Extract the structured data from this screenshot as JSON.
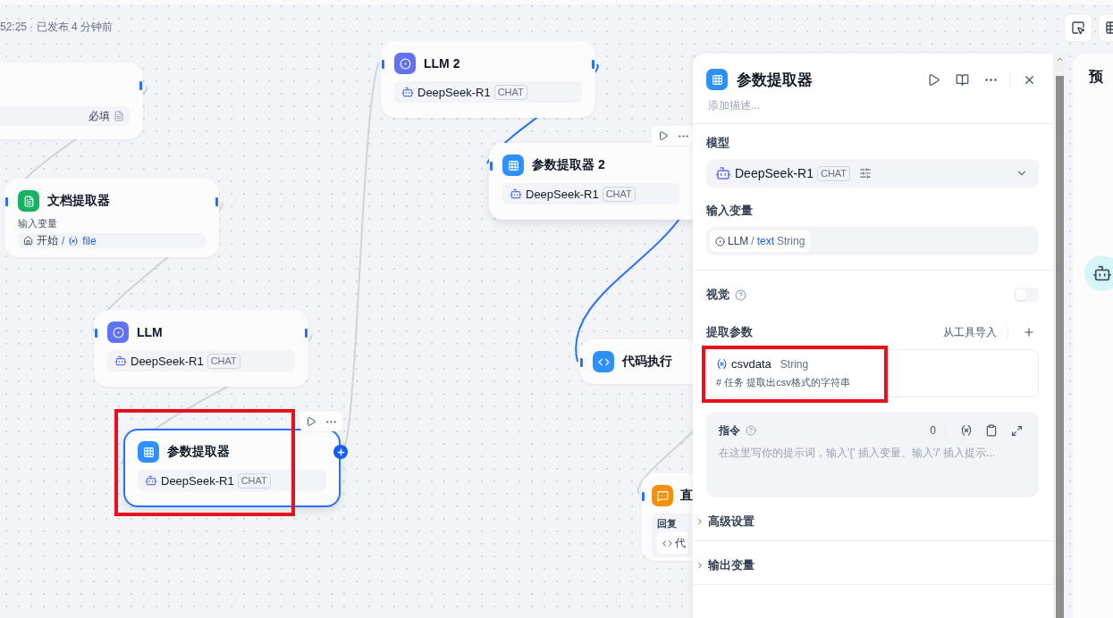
{
  "status": "52:25 · 已发布 4 分钟前",
  "nodes": [
    {
      "kind": "start",
      "required_label": "必填",
      "selected": false,
      "toolbar": false,
      "highlighted": false
    },
    {
      "kind": "doc",
      "title": "文档提取器",
      "input_label": "输入变量",
      "source": "开始",
      "separator": "/",
      "variable": "file",
      "selected": false,
      "toolbar": false,
      "highlighted": false
    },
    {
      "kind": "llm",
      "title": "LLM",
      "model": "DeepSeek-R1",
      "model_tag": "CHAT",
      "selected": false,
      "toolbar": false,
      "highlighted": false
    },
    {
      "kind": "param",
      "title": "参数提取器",
      "model": "DeepSeek-R1",
      "model_tag": "CHAT",
      "selected": true,
      "toolbar": true,
      "highlighted": true
    },
    {
      "kind": "llm",
      "title": "LLM 2",
      "model": "DeepSeek-R1",
      "model_tag": "CHAT",
      "selected": false,
      "toolbar": false,
      "highlighted": false
    },
    {
      "kind": "param",
      "title": "参数提取器 2",
      "model": "DeepSeek-R1",
      "model_tag": "CHAT",
      "selected": false,
      "toolbar": true,
      "highlighted": false
    },
    {
      "kind": "code",
      "title": "代码执行",
      "selected": false,
      "toolbar": false,
      "highlighted": false
    },
    {
      "kind": "answer",
      "title": "直",
      "reply_label": "回复",
      "reply_source": "代",
      "selected": false,
      "toolbar": false,
      "highlighted": false
    }
  ],
  "panel": {
    "title": "参数提取器",
    "description_placeholder": "添加描述...",
    "model_label": "模型",
    "model": "DeepSeek-R1",
    "model_tag": "CHAT",
    "input_label": "输入变量",
    "input": {
      "node": "LLM",
      "separator": "/",
      "variable": "text",
      "type": "String"
    },
    "vision_label": "视觉",
    "vision_on": false,
    "params_label": "提取参数",
    "import_label": "从工具导入",
    "params": [
      {
        "name": "csvdata",
        "type": "String",
        "description": "# 任务 提取出csv格式的字符串",
        "highlighted": true
      }
    ],
    "instruction": {
      "label": "指令",
      "count": "0",
      "placeholder": "在这里写你的提示词，输入'{' 插入变量、输入'/' 插入提示..."
    },
    "sections": [
      {
        "label": "高级设置",
        "expanded": false
      },
      {
        "label": "输出变量",
        "expanded": false
      }
    ]
  },
  "preview": {
    "title": "预"
  }
}
